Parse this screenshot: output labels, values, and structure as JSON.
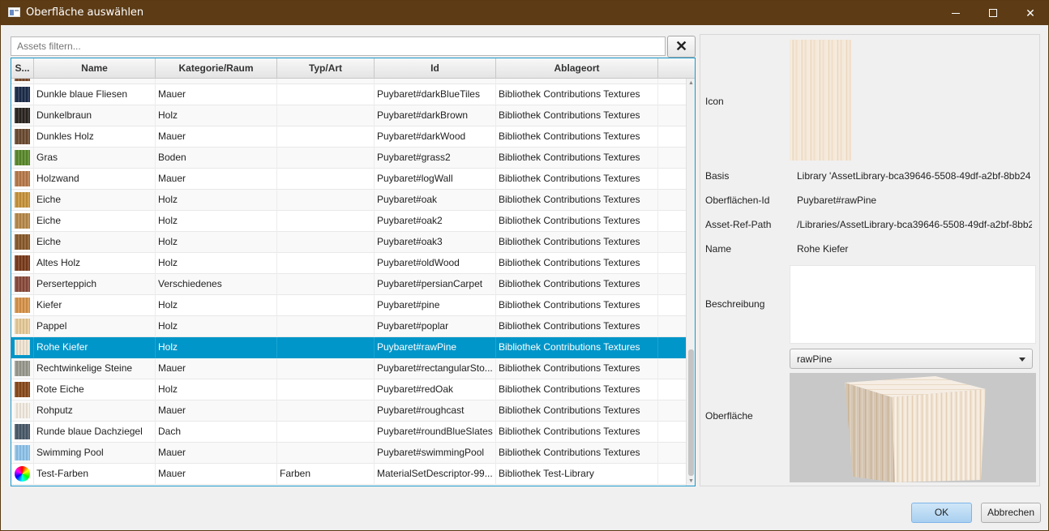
{
  "window": {
    "title": "Oberfläche auswählen",
    "minimize_glyph": "",
    "maximize_glyph": "",
    "close_glyph": "✕"
  },
  "filter": {
    "placeholder": "Assets filtern...",
    "value": "",
    "clear_label": "✕"
  },
  "table": {
    "columns": [
      "S...",
      "Name",
      "Kategorie/Raum",
      "Typ/Art",
      "Id",
      "Ablageort"
    ],
    "rows": [
      {
        "swatch": "#7a4a2a",
        "name": "",
        "category": "",
        "type": "",
        "id": "",
        "location": "",
        "partial": true
      },
      {
        "swatch": "#1b2b4a",
        "name": "Dunkle blaue Fliesen",
        "category": "Mauer",
        "type": "",
        "id": "Puybaret#darkBlueTiles",
        "location": "Bibliothek Contributions Textures"
      },
      {
        "swatch": "#2a2420",
        "name": "Dunkelbraun",
        "category": "Holz",
        "type": "",
        "id": "Puybaret#darkBrown",
        "location": "Bibliothek Contributions Textures"
      },
      {
        "swatch": "#6b4a30",
        "name": "Dunkles Holz",
        "category": "Mauer",
        "type": "",
        "id": "Puybaret#darkWood",
        "location": "Bibliothek Contributions Textures"
      },
      {
        "swatch": "#5a8a2a",
        "name": "Gras",
        "category": "Boden",
        "type": "",
        "id": "Puybaret#grass2",
        "location": "Bibliothek Contributions Textures"
      },
      {
        "swatch": "#b87a4a",
        "name": "Holzwand",
        "category": "Mauer",
        "type": "",
        "id": "Puybaret#logWall",
        "location": "Bibliothek Contributions Textures"
      },
      {
        "swatch": "#c8943a",
        "name": "Eiche",
        "category": "Holz",
        "type": "",
        "id": "Puybaret#oak",
        "location": "Bibliothek Contributions Textures"
      },
      {
        "swatch": "#b88a4a",
        "name": "Eiche",
        "category": "Holz",
        "type": "",
        "id": "Puybaret#oak2",
        "location": "Bibliothek Contributions Textures"
      },
      {
        "swatch": "#8a5a2a",
        "name": "Eiche",
        "category": "Holz",
        "type": "",
        "id": "Puybaret#oak3",
        "location": "Bibliothek Contributions Textures"
      },
      {
        "swatch": "#7a3a1a",
        "name": "Altes Holz",
        "category": "Holz",
        "type": "",
        "id": "Puybaret#oldWood",
        "location": "Bibliothek Contributions Textures"
      },
      {
        "swatch": "#8a4a3a",
        "name": "Perserteppich",
        "category": "Verschiedenes",
        "type": "",
        "id": "Puybaret#persianCarpet",
        "location": "Bibliothek Contributions Textures"
      },
      {
        "swatch": "#d8944a",
        "name": "Kiefer",
        "category": "Holz",
        "type": "",
        "id": "Puybaret#pine",
        "location": "Bibliothek Contributions Textures"
      },
      {
        "swatch": "#e8cc9a",
        "name": "Pappel",
        "category": "Holz",
        "type": "",
        "id": "Puybaret#poplar",
        "location": "Bibliothek Contributions Textures"
      },
      {
        "swatch": "#f3e6d4",
        "name": "Rohe Kiefer",
        "category": "Holz",
        "type": "",
        "id": "Puybaret#rawPine",
        "location": "Bibliothek Contributions Textures",
        "selected": true
      },
      {
        "swatch": "#9a9a90",
        "name": "Rechtwinkelige Steine",
        "category": "Mauer",
        "type": "",
        "id": "Puybaret#rectangularSto...",
        "location": "Bibliothek Contributions Textures"
      },
      {
        "swatch": "#8a4a1a",
        "name": "Rote Eiche",
        "category": "Holz",
        "type": "",
        "id": "Puybaret#redOak",
        "location": "Bibliothek Contributions Textures"
      },
      {
        "swatch": "#f4ede2",
        "name": "Rohputz",
        "category": "Mauer",
        "type": "",
        "id": "Puybaret#roughcast",
        "location": "Bibliothek Contributions Textures"
      },
      {
        "swatch": "#4a5a6a",
        "name": "Runde blaue Dachziegel",
        "category": "Dach",
        "type": "",
        "id": "Puybaret#roundBlueSlates",
        "location": "Bibliothek Contributions Textures"
      },
      {
        "swatch": "#8fc4ec",
        "name": "Swimming Pool",
        "category": "Mauer",
        "type": "",
        "id": "Puybaret#swimmingPool",
        "location": "Bibliothek Contributions Textures"
      },
      {
        "swatch": "rainbow",
        "name": "Test-Farben",
        "category": "Mauer",
        "type": "Farben",
        "id": "MaterialSetDescriptor-99...",
        "location": "Bibliothek Test-Library"
      }
    ]
  },
  "details": {
    "icon_label": "Icon",
    "basis_label": "Basis",
    "basis_value": "Library 'AssetLibrary-bca39646-5508-49df-a2bf-8bb24",
    "surface_id_label": "Oberflächen-Id",
    "surface_id_value": "Puybaret#rawPine",
    "asset_ref_label": "Asset-Ref-Path",
    "asset_ref_value": "/Libraries/AssetLibrary-bca39646-5508-49df-a2bf-8bb2",
    "name_label": "Name",
    "name_value": "Rohe Kiefer",
    "description_label": "Beschreibung",
    "surface_label": "Oberfläche",
    "surface_select_value": "rawPine"
  },
  "buttons": {
    "ok_label": "OK",
    "cancel_label": "Abbrechen"
  },
  "colors": {
    "titlebar": "#5c3b15",
    "selection": "#0096c9",
    "table_border": "#1a97c9"
  }
}
